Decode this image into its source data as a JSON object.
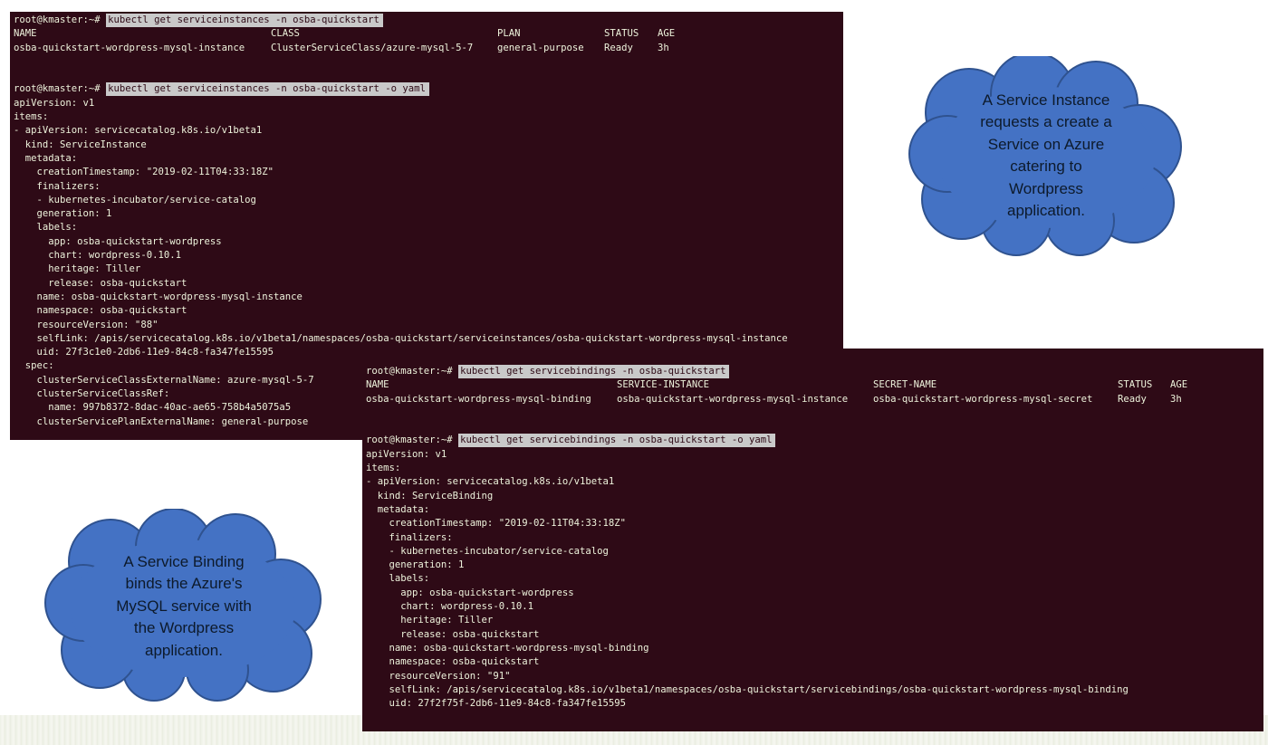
{
  "terminal_instances": {
    "prompt": "root@kmaster:~#",
    "command": "kubectl get serviceinstances -n osba-quickstart",
    "table": {
      "headers": [
        "NAME",
        "CLASS",
        "PLAN",
        "STATUS",
        "AGE"
      ],
      "row": [
        "osba-quickstart-wordpress-mysql-instance",
        "ClusterServiceClass/azure-mysql-5-7",
        "general-purpose",
        "Ready",
        "3h"
      ]
    },
    "yaml_command": "kubectl get serviceinstances -n osba-quickstart -o yaml",
    "yaml_lines": [
      "apiVersion: v1",
      "items:",
      "- apiVersion: servicecatalog.k8s.io/v1beta1",
      "  kind: ServiceInstance",
      "  metadata:",
      "    creationTimestamp: \"2019-02-11T04:33:18Z\"",
      "    finalizers:",
      "    - kubernetes-incubator/service-catalog",
      "    generation: 1",
      "    labels:",
      "      app: osba-quickstart-wordpress",
      "      chart: wordpress-0.10.1",
      "      heritage: Tiller",
      "      release: osba-quickstart",
      "    name: osba-quickstart-wordpress-mysql-instance",
      "    namespace: osba-quickstart",
      "    resourceVersion: \"88\"",
      "    selfLink: /apis/servicecatalog.k8s.io/v1beta1/namespaces/osba-quickstart/serviceinstances/osba-quickstart-wordpress-mysql-instance",
      "    uid: 27f3c1e0-2db6-11e9-84c8-fa347fe15595",
      "  spec:",
      "    clusterServiceClassExternalName: azure-mysql-5-7",
      "    clusterServiceClassRef:",
      "      name: 997b8372-8dac-40ac-ae65-758b4a5075a5",
      "    clusterServicePlanExternalName: general-purpose"
    ]
  },
  "terminal_bindings": {
    "prompt": "root@kmaster:~#",
    "command": "kubectl get servicebindings -n osba-quickstart",
    "table": {
      "headers": [
        "NAME",
        "SERVICE-INSTANCE",
        "SECRET-NAME",
        "STATUS",
        "AGE"
      ],
      "row": [
        "osba-quickstart-wordpress-mysql-binding",
        "osba-quickstart-wordpress-mysql-instance",
        "osba-quickstart-wordpress-mysql-secret",
        "Ready",
        "3h"
      ]
    },
    "yaml_command": "kubectl get servicebindings -n osba-quickstart -o yaml",
    "yaml_lines": [
      "apiVersion: v1",
      "items:",
      "- apiVersion: servicecatalog.k8s.io/v1beta1",
      "  kind: ServiceBinding",
      "  metadata:",
      "    creationTimestamp: \"2019-02-11T04:33:18Z\"",
      "    finalizers:",
      "    - kubernetes-incubator/service-catalog",
      "    generation: 1",
      "    labels:",
      "      app: osba-quickstart-wordpress",
      "      chart: wordpress-0.10.1",
      "      heritage: Tiller",
      "      release: osba-quickstart",
      "    name: osba-quickstart-wordpress-mysql-binding",
      "    namespace: osba-quickstart",
      "    resourceVersion: \"91\"",
      "    selfLink: /apis/servicecatalog.k8s.io/v1beta1/namespaces/osba-quickstart/servicebindings/osba-quickstart-wordpress-mysql-binding",
      "    uid: 27f2f75f-2db6-11e9-84c8-fa347fe15595"
    ]
  },
  "callouts": {
    "service_instance": [
      "A Service Instance",
      "requests a create a",
      "Service on Azure",
      "catering to",
      "Wordpress",
      "application."
    ],
    "service_binding": [
      "A Service Binding",
      "binds the Azure's",
      "MySQL service with",
      "the Wordpress",
      "application."
    ]
  },
  "colors": {
    "terminal_bg": "#2e0a16",
    "terminal_text": "#eef3dc",
    "command_highlight": "#c9c9c9",
    "cloud_fill": "#4472c4",
    "cloud_stroke": "#2f528f"
  }
}
